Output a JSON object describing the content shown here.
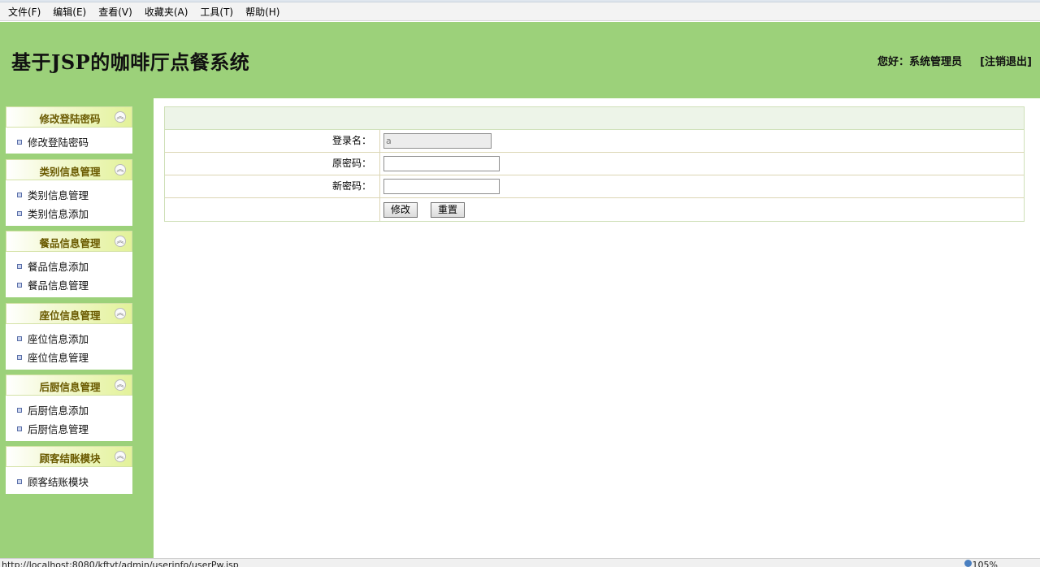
{
  "menu": [
    "文件(F)",
    "编辑(E)",
    "查看(V)",
    "收藏夹(A)",
    "工具(T)",
    "帮助(H)"
  ],
  "header": {
    "title": "基于JSP的咖啡厅点餐系统",
    "greeting": "您好：系统管理员",
    "logout": "[注销退出]"
  },
  "sidebar": [
    {
      "title": "修改登陆密码",
      "items": [
        "修改登陆密码"
      ]
    },
    {
      "title": "类别信息管理",
      "items": [
        "类别信息管理",
        "类别信息添加"
      ]
    },
    {
      "title": "餐品信息管理",
      "items": [
        "餐品信息添加",
        "餐品信息管理"
      ]
    },
    {
      "title": "座位信息管理",
      "items": [
        "座位信息添加",
        "座位信息管理"
      ]
    },
    {
      "title": "后厨信息管理",
      "items": [
        "后厨信息添加",
        "后厨信息管理"
      ]
    },
    {
      "title": "顾客结账模块",
      "items": [
        "顾客结账模块"
      ]
    }
  ],
  "form": {
    "login_label": "登录名：",
    "login_value": "a",
    "old_pw_label": "原密码：",
    "new_pw_label": "新密码：",
    "submit": "修改",
    "reset": "重置"
  },
  "status": {
    "url": "http://localhost:8080/kftvt/admin/userinfo/userPw.jsp",
    "zoom": "105%"
  },
  "colors": {
    "header_bg": "#9cd17a",
    "panel_title": "#6a5a00",
    "form_border": "#cfe0b8"
  }
}
